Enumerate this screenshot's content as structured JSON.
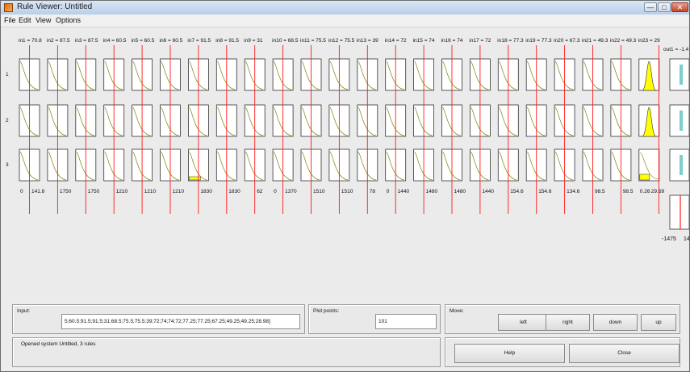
{
  "window": {
    "title": "Rule Viewer: Untitled",
    "min_glyph": "—",
    "max_glyph": "□",
    "close_glyph": "✕"
  },
  "menu": [
    "File",
    "Edit",
    "View",
    "Options"
  ],
  "inputs": [
    {
      "label": "in1 = 70.8",
      "range_min": "0",
      "range_max": "141.8",
      "line": 0.5,
      "low_fill": 0
    },
    {
      "label": "in2 = 87.5",
      "range_min": "",
      "range_max": "1750",
      "line": 0.5,
      "low_fill": 0
    },
    {
      "label": "in3 = 87.5",
      "range_min": "",
      "range_max": "1750",
      "line": 0.5,
      "low_fill": 0
    },
    {
      "label": "in4 = 60.5",
      "range_min": "",
      "range_max": "1210",
      "line": 0.5,
      "low_fill": 0
    },
    {
      "label": "in5 = 60.5",
      "range_min": "",
      "range_max": "1210",
      "line": 0.5,
      "low_fill": 0
    },
    {
      "label": "in6 = 60.5",
      "range_min": "",
      "range_max": "1210",
      "line": 0.5,
      "low_fill": 0
    },
    {
      "label": "in7 = 91.5",
      "range_min": "",
      "range_max": "1830",
      "line": 0.5,
      "low_fill": 1
    },
    {
      "label": "in8 = 91.5",
      "range_min": "",
      "range_max": "1830",
      "line": 0.5,
      "low_fill": 0
    },
    {
      "label": "in9 = 31",
      "range_min": "",
      "range_max": "62",
      "line": 0.5,
      "low_fill": 0
    },
    {
      "label": "in10 = 68.5",
      "range_min": "0",
      "range_max": "1370",
      "line": 0.5,
      "low_fill": 0
    },
    {
      "label": "in11 = 75.5",
      "range_min": "",
      "range_max": "1510",
      "line": 0.5,
      "low_fill": 0
    },
    {
      "label": "in12 = 75.5",
      "range_min": "",
      "range_max": "1510",
      "line": 0.5,
      "low_fill": 0
    },
    {
      "label": "in13 = 39",
      "range_min": "",
      "range_max": "78",
      "line": 0.5,
      "low_fill": 0
    },
    {
      "label": "in14 = 72",
      "range_min": "0",
      "range_max": "1440",
      "line": 0.5,
      "low_fill": 0
    },
    {
      "label": "in15 = 74",
      "range_min": "",
      "range_max": "1480",
      "line": 0.5,
      "low_fill": 0
    },
    {
      "label": "in16 = 74",
      "range_min": "",
      "range_max": "1480",
      "line": 0.5,
      "low_fill": 0
    },
    {
      "label": "in17 = 72",
      "range_min": "",
      "range_max": "1440",
      "line": 0.5,
      "low_fill": 0
    },
    {
      "label": "in18 = 77.3",
      "range_min": "",
      "range_max": "154.6",
      "line": 0.5,
      "low_fill": 0
    },
    {
      "label": "in19 = 77.3",
      "range_min": "",
      "range_max": "154.6",
      "line": 0.5,
      "low_fill": 0
    },
    {
      "label": "in20 = 67.3",
      "range_min": "",
      "range_max": "134.6",
      "line": 0.5,
      "low_fill": 0
    },
    {
      "label": "in21 = 49.3",
      "range_min": "",
      "range_max": "98.5",
      "line": 0.5,
      "low_fill": 0
    },
    {
      "label": "in22 = 49.3",
      "range_min": "",
      "range_max": "98.5",
      "line": 0.5,
      "low_fill": 0
    },
    {
      "label": "in23 = 29",
      "range_min": "0.26",
      "range_max": "29.69",
      "line": 0.985,
      "low_fill": 1
    }
  ],
  "output": {
    "label": "out1 = -1.4",
    "min_tick": "-1475",
    "max_tick": "14"
  },
  "rules": [
    "1",
    "2",
    "3"
  ],
  "input_panel": {
    "label": "Input:",
    "value": "5;60.5;91.5;91.5;31;68.5;75.5;75.5;39;72;74;74;72;77.25;77.25;67.25;49.25;49.25;28.98]"
  },
  "plot_panel": {
    "label": "Plot points:",
    "value": "101"
  },
  "move_panel": {
    "label": "Move:",
    "buttons": [
      "left",
      "right",
      "down",
      "up"
    ]
  },
  "status": {
    "text": "Opened system Untitled, 3 rules"
  },
  "help_label": "Help",
  "close_label": "Close",
  "colors": {
    "red": "#ff1a1a",
    "yellow": "#ffff00",
    "teal": "#7fcccc",
    "mf_line": "#7a7a00"
  }
}
